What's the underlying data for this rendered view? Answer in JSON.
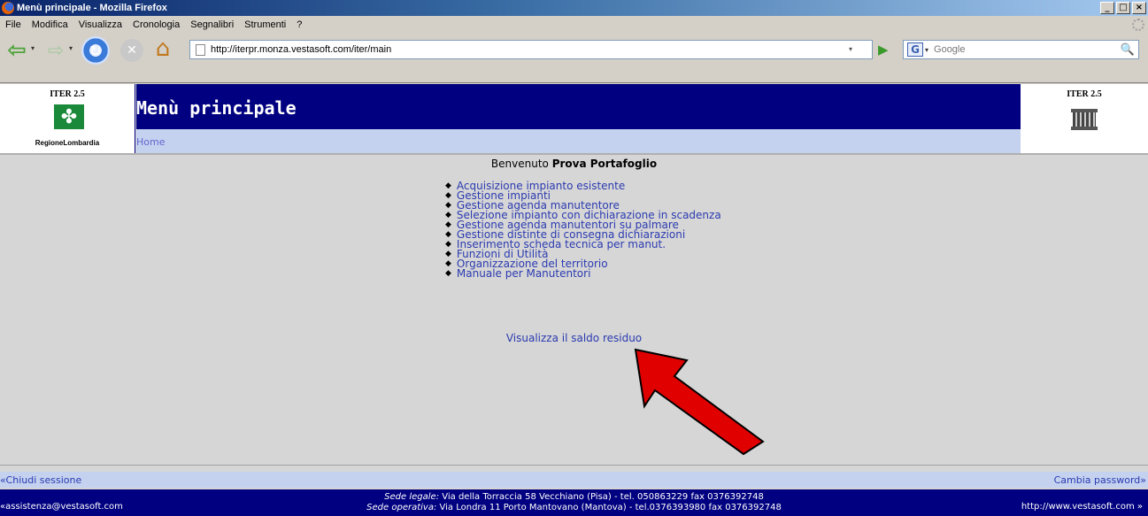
{
  "window": {
    "title": "Menù principale - Mozilla Firefox",
    "buttons": [
      "_",
      "□",
      "×"
    ]
  },
  "menubar": {
    "items": [
      "File",
      "Modifica",
      "Visualizza",
      "Cronologia",
      "Segnalibri",
      "Strumenti",
      "?"
    ]
  },
  "toolbar": {
    "url": "http://iterpr.monza.vestasoft.com/iter/main",
    "search_placeholder": "Google",
    "icons": {
      "back": "⇦",
      "forward": "⇨",
      "dropdown": "▾",
      "reload": "↻",
      "stop": "✕",
      "home": "⌂",
      "go": "▶",
      "google": "G",
      "search": "🔍"
    }
  },
  "header": {
    "left_label": "ITER 2.5",
    "left_logo_symbol": "✤",
    "left_logo_text": "RegioneLombardia",
    "right_label": "ITER 2.5",
    "title": "Menù principale",
    "breadcrumb": "Home"
  },
  "welcome": {
    "prefix": "Benvenuto",
    "user": "Prova Portafoglio"
  },
  "menu_bullet": "◆",
  "menu_items": [
    "Acquisizione impianto esistente",
    "Gestione impianti",
    "Gestione agenda manutentore",
    "Selezione impianto con dichiarazione in scadenza",
    "Gestione agenda manutentori su palmare",
    "Gestione distinte di consegna dichiarazioni",
    "Inserimento scheda tecnica per manut.",
    "Funzioni di Utilità",
    "Organizzazione del territorio",
    "Manuale per Manutentori"
  ],
  "saldo_link": "Visualizza il saldo residuo",
  "bottom": {
    "logout": "«Chiudi sessione",
    "change_password": "Cambia password»"
  },
  "footer": {
    "email": "«assistenza@vestasoft.com",
    "url": "http://www.vestasoft.com »",
    "legal_label": "Sede legale:",
    "legal_text": "Via della Torraccia 58 Vecchiano (Pisa) - tel. 050863229 fax 0376392748",
    "operative_label": "Sede operativa:",
    "operative_text": "Via Londra 11 Porto Mantovano (Mantova) - tel.0376393980 fax 0376392748"
  },
  "colors": {
    "header_blue": "#000080",
    "breadcrumb_bar": "#c4d2f0",
    "link": "#2a3ab0",
    "arrow": "#e00000"
  }
}
